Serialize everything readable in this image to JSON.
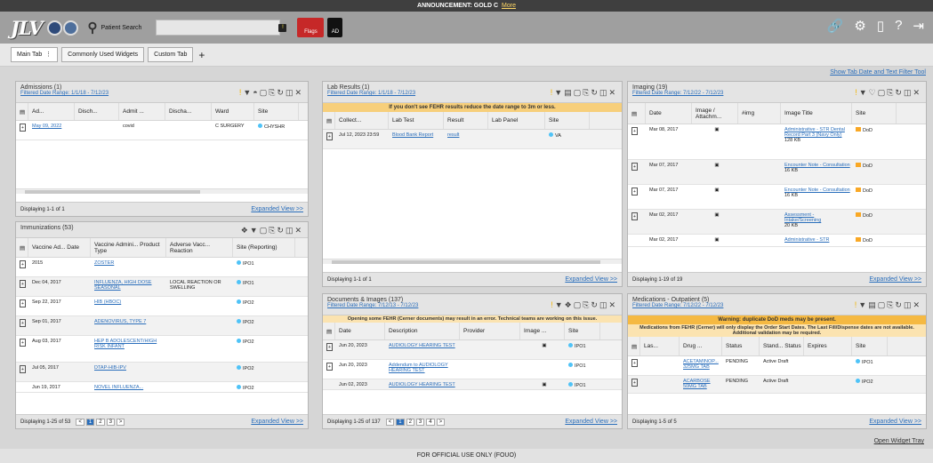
{
  "announcement": {
    "text": "ANNOUNCEMENT: GOLD C",
    "more": "More"
  },
  "header": {
    "logo": "JLV",
    "patient_search": "Patient Search",
    "flags": "Flags",
    "ad": "AD"
  },
  "tabs": [
    {
      "label": "Main Tab"
    },
    {
      "label": "Commonly Used Widgets"
    },
    {
      "label": "Custom Tab"
    }
  ],
  "show_tab_date": "Show Tab Date and Text Filter Tool",
  "admissions": {
    "title": "Admissions (1)",
    "range": "Filtered Date Range: 1/1/18 - 7/12/23",
    "cols": [
      "Ad...",
      "Disch...",
      "Admit ...",
      "Discha...",
      "Ward",
      "Site"
    ],
    "rows": [
      {
        "date": "May 09, 2022",
        "disch": "",
        "admit": "covid",
        "discha": "",
        "ward": "C SURGERY",
        "site": "CHYSHR"
      }
    ],
    "footer": "Displaying 1-1 of 1",
    "expanded": "Expanded View >>"
  },
  "immunizations": {
    "title": "Immunizations (53)",
    "cols": [
      "Vaccine Ad... Date",
      "Vaccine Admini... Product Type",
      "Adverse Vacc... Reaction",
      "Site (Reporting)"
    ],
    "rows": [
      {
        "date": "2015",
        "product": "ZOSTER",
        "reaction": "",
        "site": "IPO1"
      },
      {
        "date": "Dec 04, 2017",
        "product": "INFLUENZA, HIGH DOSE SEASONAL",
        "reaction": "LOCAL REACTION OR SWELLING",
        "site": "IPO1"
      },
      {
        "date": "Sep 22, 2017",
        "product": "HIB (HBOC)",
        "reaction": "",
        "site": "IPO2"
      },
      {
        "date": "Sep 01, 2017",
        "product": "ADENOVIRUS, TYPE 7",
        "reaction": "",
        "site": "IPO2"
      },
      {
        "date": "Aug 03, 2017",
        "product": "HEP B ADOLESCENT/HIGH RISK INFANT",
        "reaction": "",
        "site": "IPO2"
      },
      {
        "date": "Jul 05, 2017",
        "product": "DTAP-HIB-IPV",
        "reaction": "",
        "site": "IPO2"
      },
      {
        "date": "Jun 19, 2017",
        "product": "NOVEL INFLUENZA...",
        "reaction": "",
        "site": "IPO2"
      }
    ],
    "footer": "Displaying 1-25 of 53",
    "pages": [
      "1",
      "2",
      "3"
    ],
    "expanded": "Expanded View >>"
  },
  "labs": {
    "title": "Lab Results (1)",
    "range": "Filtered Date Range: 1/1/18 - 7/12/23",
    "warn": "If you don't see FEHR results reduce the date range to 3m or less.",
    "cols": [
      "Collect...",
      "Lab Test",
      "Result",
      "Lab Panel",
      "Site"
    ],
    "rows": [
      {
        "date": "Jul 12, 2023 23:59",
        "test": "Blood Bank Report",
        "result": "result",
        "panel": "",
        "site": "VA"
      }
    ],
    "footer": "Displaying 1-1 of 1",
    "expanded": "Expanded View >>"
  },
  "documents": {
    "title": "Documents & Images (137)",
    "range": "Filtered Date Range: 7/12/13 - 7/12/23",
    "warn": "Opening some FEHR (Cerner documents) may result in an error. Technical teams are working on this issue.",
    "cols": [
      "Date",
      "Description",
      "Provider",
      "Image ...",
      "Site"
    ],
    "rows": [
      {
        "date": "Jun 20, 2023",
        "desc": "AUDIOLOGY HEARING TEST",
        "site": "IPO1"
      },
      {
        "date": "Jun 20, 2023",
        "desc": "Addendum to AUDIOLOGY HEARING TEST",
        "site": "IPO1"
      },
      {
        "date": "Jun 02, 2023",
        "desc": "AUDIOLOGY HEARING TEST",
        "site": "IPO1"
      }
    ],
    "footer": "Displaying 1-25 of 137",
    "pages": [
      "1",
      "2",
      "3",
      "4"
    ],
    "expanded": "Expanded View >>"
  },
  "imaging": {
    "title": "Imaging (19)",
    "range": "Filtered Date Range: 7/12/22 - 7/12/23",
    "cols": [
      "Date",
      "Image / Attachm...",
      "#img",
      "Image Title",
      "Site"
    ],
    "rows": [
      {
        "date": "Mar 08, 2017",
        "title": "Administrative - STR Dental Record Part 3 (Navy Only)",
        "size": "128 KB",
        "site": "DoD"
      },
      {
        "date": "Mar 07, 2017",
        "title": "Encounter Note - Consultation",
        "size": "16 KB",
        "site": "DoD"
      },
      {
        "date": "Mar 07, 2017",
        "title": "Encounter Note - Consultation",
        "size": "16 KB",
        "site": "DoD"
      },
      {
        "date": "Mar 02, 2017",
        "title": "Assessment - Intake/Screening",
        "size": "20 KB",
        "site": "DoD"
      },
      {
        "date": "Mar 02, 2017",
        "title": "Administrative - STR",
        "size": "",
        "site": "DoD"
      }
    ],
    "footer": "Displaying 1-19 of 19",
    "expanded": "Expanded View >>"
  },
  "meds": {
    "title": "Medications - Outpatient (5)",
    "range": "Filtered Date Range: 7/12/22 - 7/12/23",
    "warn": "Warning: duplicate DoD meds may be present.",
    "warn2": "Medications from FEHR (Cerner) will only display the Order Start Dates. The Last Fill/Dispense dates are not available. Additional validation may be required.",
    "cols": [
      "Las...",
      "Drug ...",
      "Status",
      "Stand... Status",
      "Expires",
      "Site"
    ],
    "rows": [
      {
        "drug": "ACETAMINOP... 325MG TAB",
        "status": "PENDING",
        "std": "Active Draft",
        "site": "IPO1"
      },
      {
        "drug": "ACARBOSE 50MG TAB",
        "status": "PENDING",
        "std": "Active Draft",
        "site": "IPO2"
      }
    ],
    "footer": "Displaying 1-5 of 5",
    "expanded": "Expanded View >>"
  },
  "open_widget_tray": "Open Widget Tray",
  "fouo": "FOR OFFICIAL USE ONLY (FOUO)"
}
